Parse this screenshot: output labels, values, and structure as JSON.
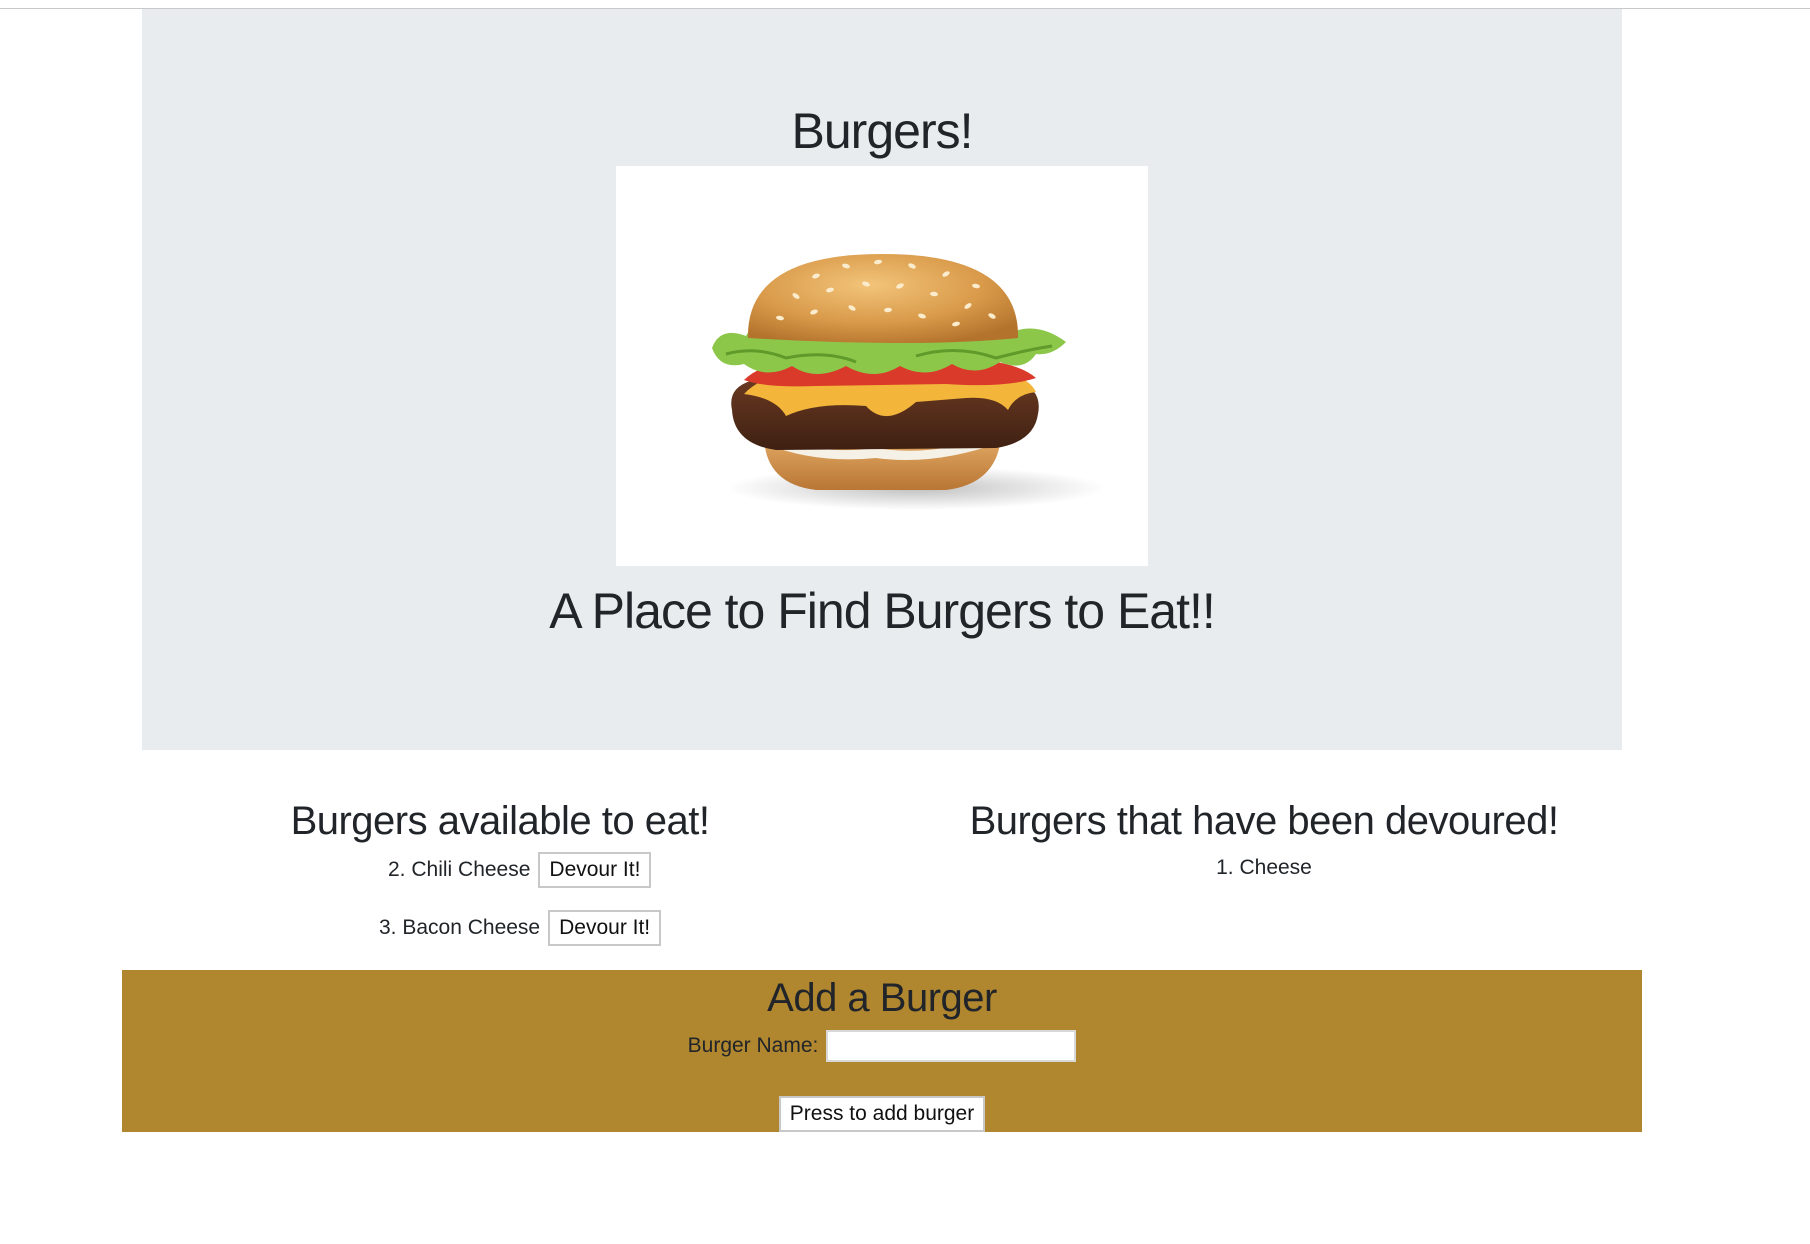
{
  "header": {
    "title": "Burgers!",
    "tagline": "A Place to Find Burgers to Eat!!"
  },
  "available": {
    "heading": "Burgers available to eat!",
    "items": [
      {
        "label": "2. Chili Cheese",
        "button": "Devour It!"
      },
      {
        "label": "3. Bacon Cheese",
        "button": "Devour It!"
      }
    ]
  },
  "devoured": {
    "heading": "Burgers that have been devoured!",
    "items": [
      {
        "label": "1. Cheese"
      }
    ]
  },
  "form": {
    "heading": "Add a Burger",
    "name_label": "Burger Name:",
    "name_value": "",
    "submit_label": "Press to add burger"
  },
  "colors": {
    "jumbotron_bg": "#e9ecef",
    "form_bg": "#b0862f",
    "text": "#212529"
  }
}
